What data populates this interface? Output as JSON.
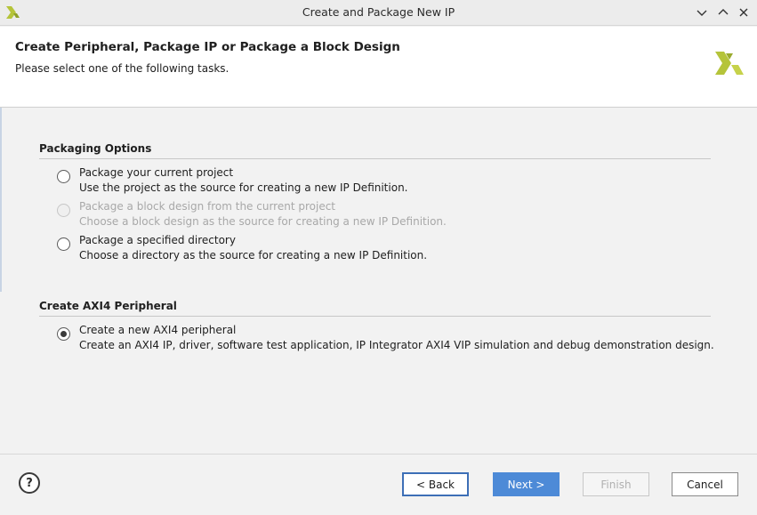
{
  "window": {
    "title": "Create and Package New IP",
    "controls": [
      "chevron-down-icon",
      "chevron-up-icon",
      "close-icon"
    ]
  },
  "header": {
    "title": "Create Peripheral, Package IP or Package a Block Design",
    "subtitle": "Please select one of the following tasks."
  },
  "packaging": {
    "title": "Packaging Options",
    "options": [
      {
        "label": "Package your current project",
        "desc": "Use the project as the source for creating a new IP Definition.",
        "state": "unselected"
      },
      {
        "label": "Package a block design from the current project",
        "desc": "Choose a block design as the source for creating a new IP Definition.",
        "state": "disabled"
      },
      {
        "label": "Package a specified directory",
        "desc": "Choose a directory as the source for creating a new IP Definition.",
        "state": "unselected"
      }
    ]
  },
  "axi4": {
    "title": "Create AXI4 Peripheral",
    "options": [
      {
        "label": "Create a new AXI4 peripheral",
        "desc": "Create an AXI4 IP, driver, software test application, IP Integrator AXI4 VIP simulation and debug demonstration design.",
        "state": "selected"
      }
    ]
  },
  "footer": {
    "help": "?",
    "back": "< Back",
    "next": "Next >",
    "finish": "Finish",
    "cancel": "Cancel"
  },
  "colors": {
    "logo": "#b5c43a",
    "primary_button": "#4d8ad7",
    "header_bg": "#ffffff",
    "body_bg": "#f2f2f2"
  }
}
